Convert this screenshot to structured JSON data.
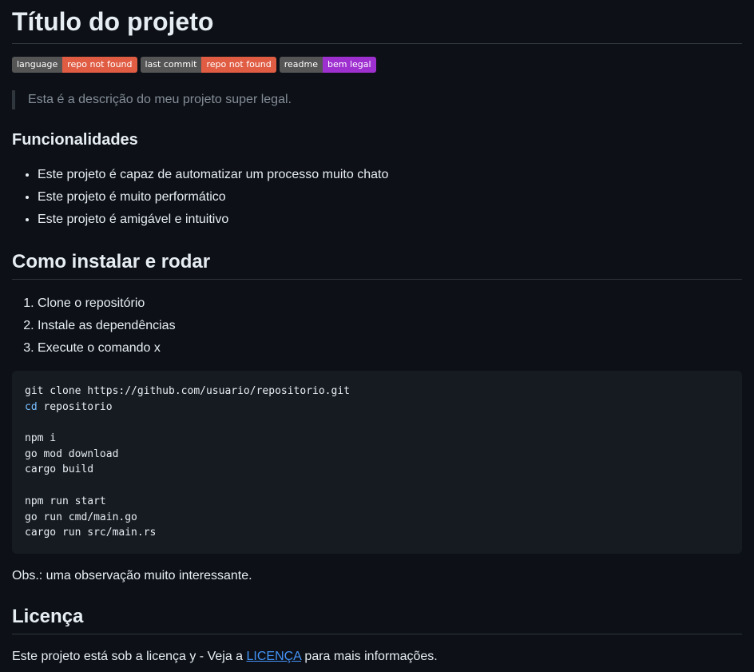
{
  "title": "Título do projeto",
  "badges": [
    {
      "label": "language",
      "value": "repo not found",
      "color": "#e05d44"
    },
    {
      "label": "last commit",
      "value": "repo not found",
      "color": "#e05d44"
    },
    {
      "label": "readme",
      "value": "bem legal",
      "color": "#9f30d0"
    }
  ],
  "description": "Esta é a descrição do meu projeto super legal.",
  "features": {
    "heading": "Funcionalidades",
    "items": [
      "Este projeto é capaz de automatizar um processo muito chato",
      "Este projeto é muito performático",
      "Este projeto é amigável e intuitivo"
    ]
  },
  "install": {
    "heading": "Como instalar e rodar",
    "steps": [
      "Clone o repositório",
      "Instale as dependências",
      "Execute o comando x"
    ],
    "code": {
      "line1": "git clone https://github.com/usuario/repositorio.git",
      "line2_kw": "cd",
      "line2_rest": " repositorio",
      "line3": "npm i",
      "line4": "go mod download",
      "line5": "cargo build",
      "line6": "npm run start",
      "line7": "go run cmd/main.go",
      "line8": "cargo run src/main.rs"
    },
    "note": "Obs.: uma observação muito interessante."
  },
  "license": {
    "heading": "Licença",
    "text_before": "Este projeto está sob a licença y - Veja a ",
    "link": "LICENÇA",
    "text_after": " para mais informações."
  },
  "colors": {
    "background": "#0d1117",
    "link": "#4493f8",
    "code_bg": "#161b22",
    "keyword": "#79c0ff"
  }
}
